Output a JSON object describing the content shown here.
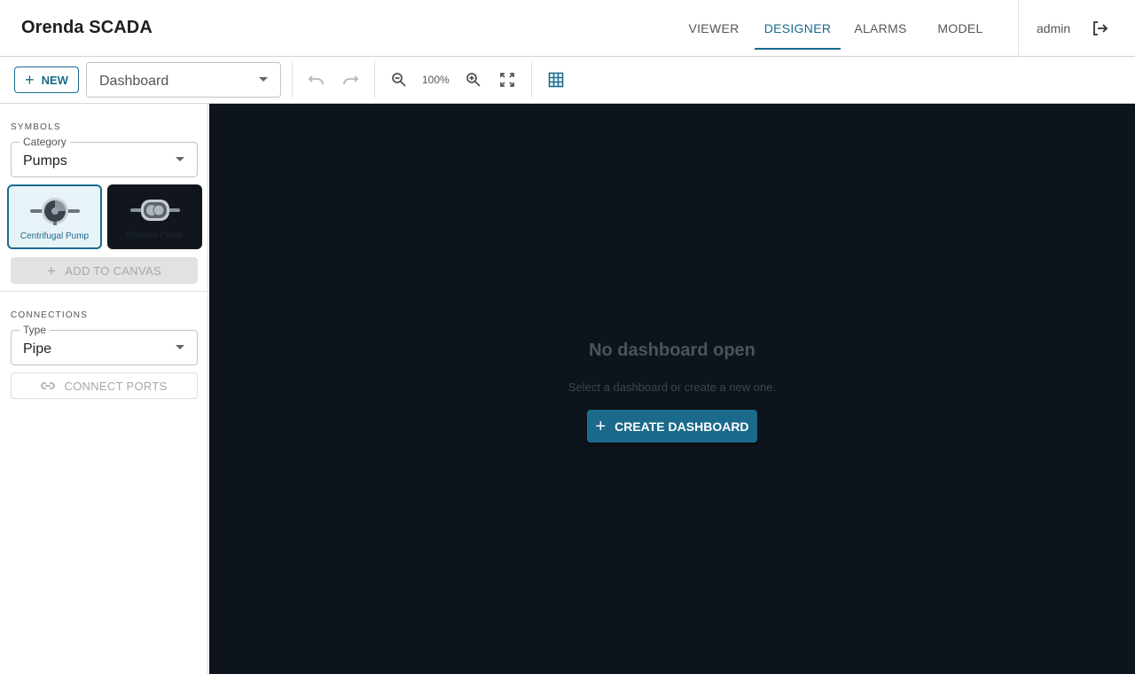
{
  "app": {
    "title": "Orenda SCADA"
  },
  "nav": {
    "tabs": [
      {
        "label": "VIEWER",
        "active": false
      },
      {
        "label": "DESIGNER",
        "active": true
      },
      {
        "label": "ALARMS",
        "active": false
      },
      {
        "label": "MODEL",
        "active": false
      }
    ],
    "user": "admin"
  },
  "toolbar": {
    "new_label": "NEW",
    "dashboard_select": {
      "value": "Dashboard"
    },
    "zoom_level": "100%"
  },
  "sidebar": {
    "symbols": {
      "title": "SYMBOLS",
      "category_legend": "Category",
      "category_value": "Pumps",
      "items": [
        {
          "label": "Centrifugal Pump",
          "selected": true
        },
        {
          "label": "Positive Pump",
          "selected": false
        }
      ],
      "add_button": "ADD TO CANVAS"
    },
    "connections": {
      "title": "CONNECTIONS",
      "type_legend": "Type",
      "type_value": "Pipe",
      "connect_button": "CONNECT PORTS"
    }
  },
  "canvas": {
    "empty_title": "No dashboard open",
    "empty_subtitle": "Select a dashboard or create a new one.",
    "create_button": "CREATE DASHBOARD"
  },
  "colors": {
    "accent": "#1b6a8c",
    "canvas_bg": "#0e141b"
  }
}
